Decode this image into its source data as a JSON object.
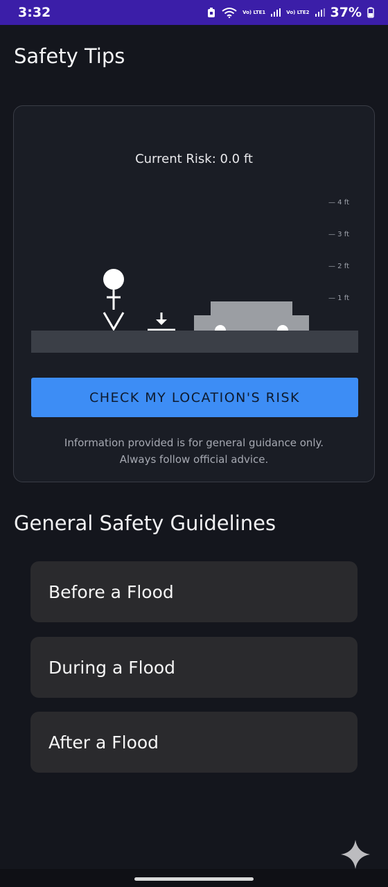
{
  "status_bar": {
    "time": "3:32",
    "signal1_label": "Vo) LTE1",
    "signal2_label": "Vo) LTE2",
    "battery": "37%"
  },
  "header": {
    "title": "Safety Tips"
  },
  "risk_card": {
    "current_risk_label": "Current Risk: 0.0 ft",
    "scale_ticks": [
      "— 4 ft",
      "— 3 ft",
      "— 2 ft",
      "— 1 ft"
    ],
    "check_button_label": "CHECK MY LOCATION'S RISK",
    "disclaimer_line1": "Information provided is for general guidance only.",
    "disclaimer_line2": "Always follow official advice."
  },
  "guidelines": {
    "title": "General Safety Guidelines",
    "items": [
      {
        "label": "Before a Flood"
      },
      {
        "label": "During a Flood"
      },
      {
        "label": "After a Flood"
      }
    ]
  },
  "colors": {
    "background": "#14161d",
    "status_bar": "#3b1ea8",
    "button": "#3d8df5",
    "card": "#1a1d25",
    "list_item": "#2a2a2d"
  },
  "icons": {
    "person": "person-icon",
    "depth_marker": "water-level-marker-icon",
    "car": "car-icon",
    "assistant": "sparkle-icon"
  }
}
